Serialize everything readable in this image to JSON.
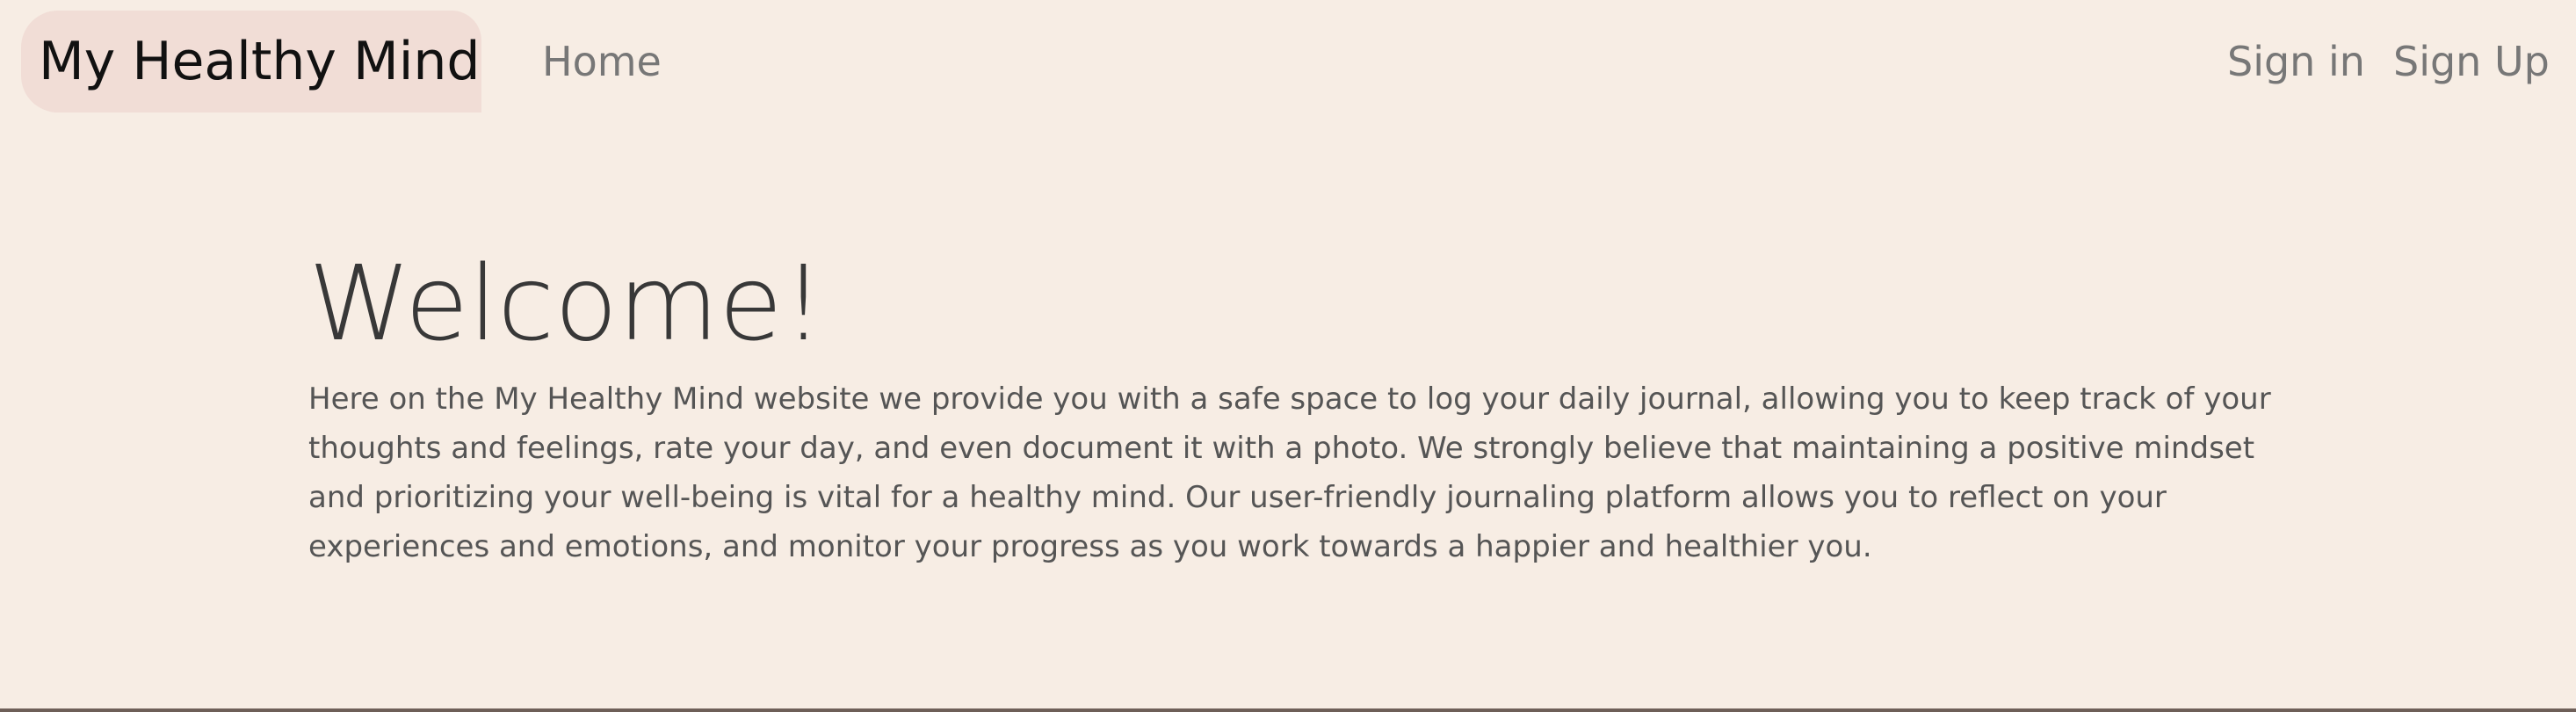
{
  "navbar": {
    "brand": "My Healthy Mind",
    "home": "Home",
    "sign_in": "Sign in",
    "sign_up": "Sign Up"
  },
  "hero": {
    "title": "Welcome!",
    "text": "Here on the My Healthy Mind website we provide you with a safe space to log your daily journal, allowing you to keep track of your thoughts and feelings, rate your day, and even document it with a photo. We strongly believe that maintaining a positive mindset and prioritizing your well-being is vital for a healthy mind. Our user-friendly journaling platform allows you to reflect on your experiences and emotions, and monitor your progress as you work towards a happier and healthier you."
  },
  "colors": {
    "background": "#f7ede4",
    "brand_background": "#f1ddd6",
    "nav_link": "#777777",
    "text": "#555555"
  }
}
